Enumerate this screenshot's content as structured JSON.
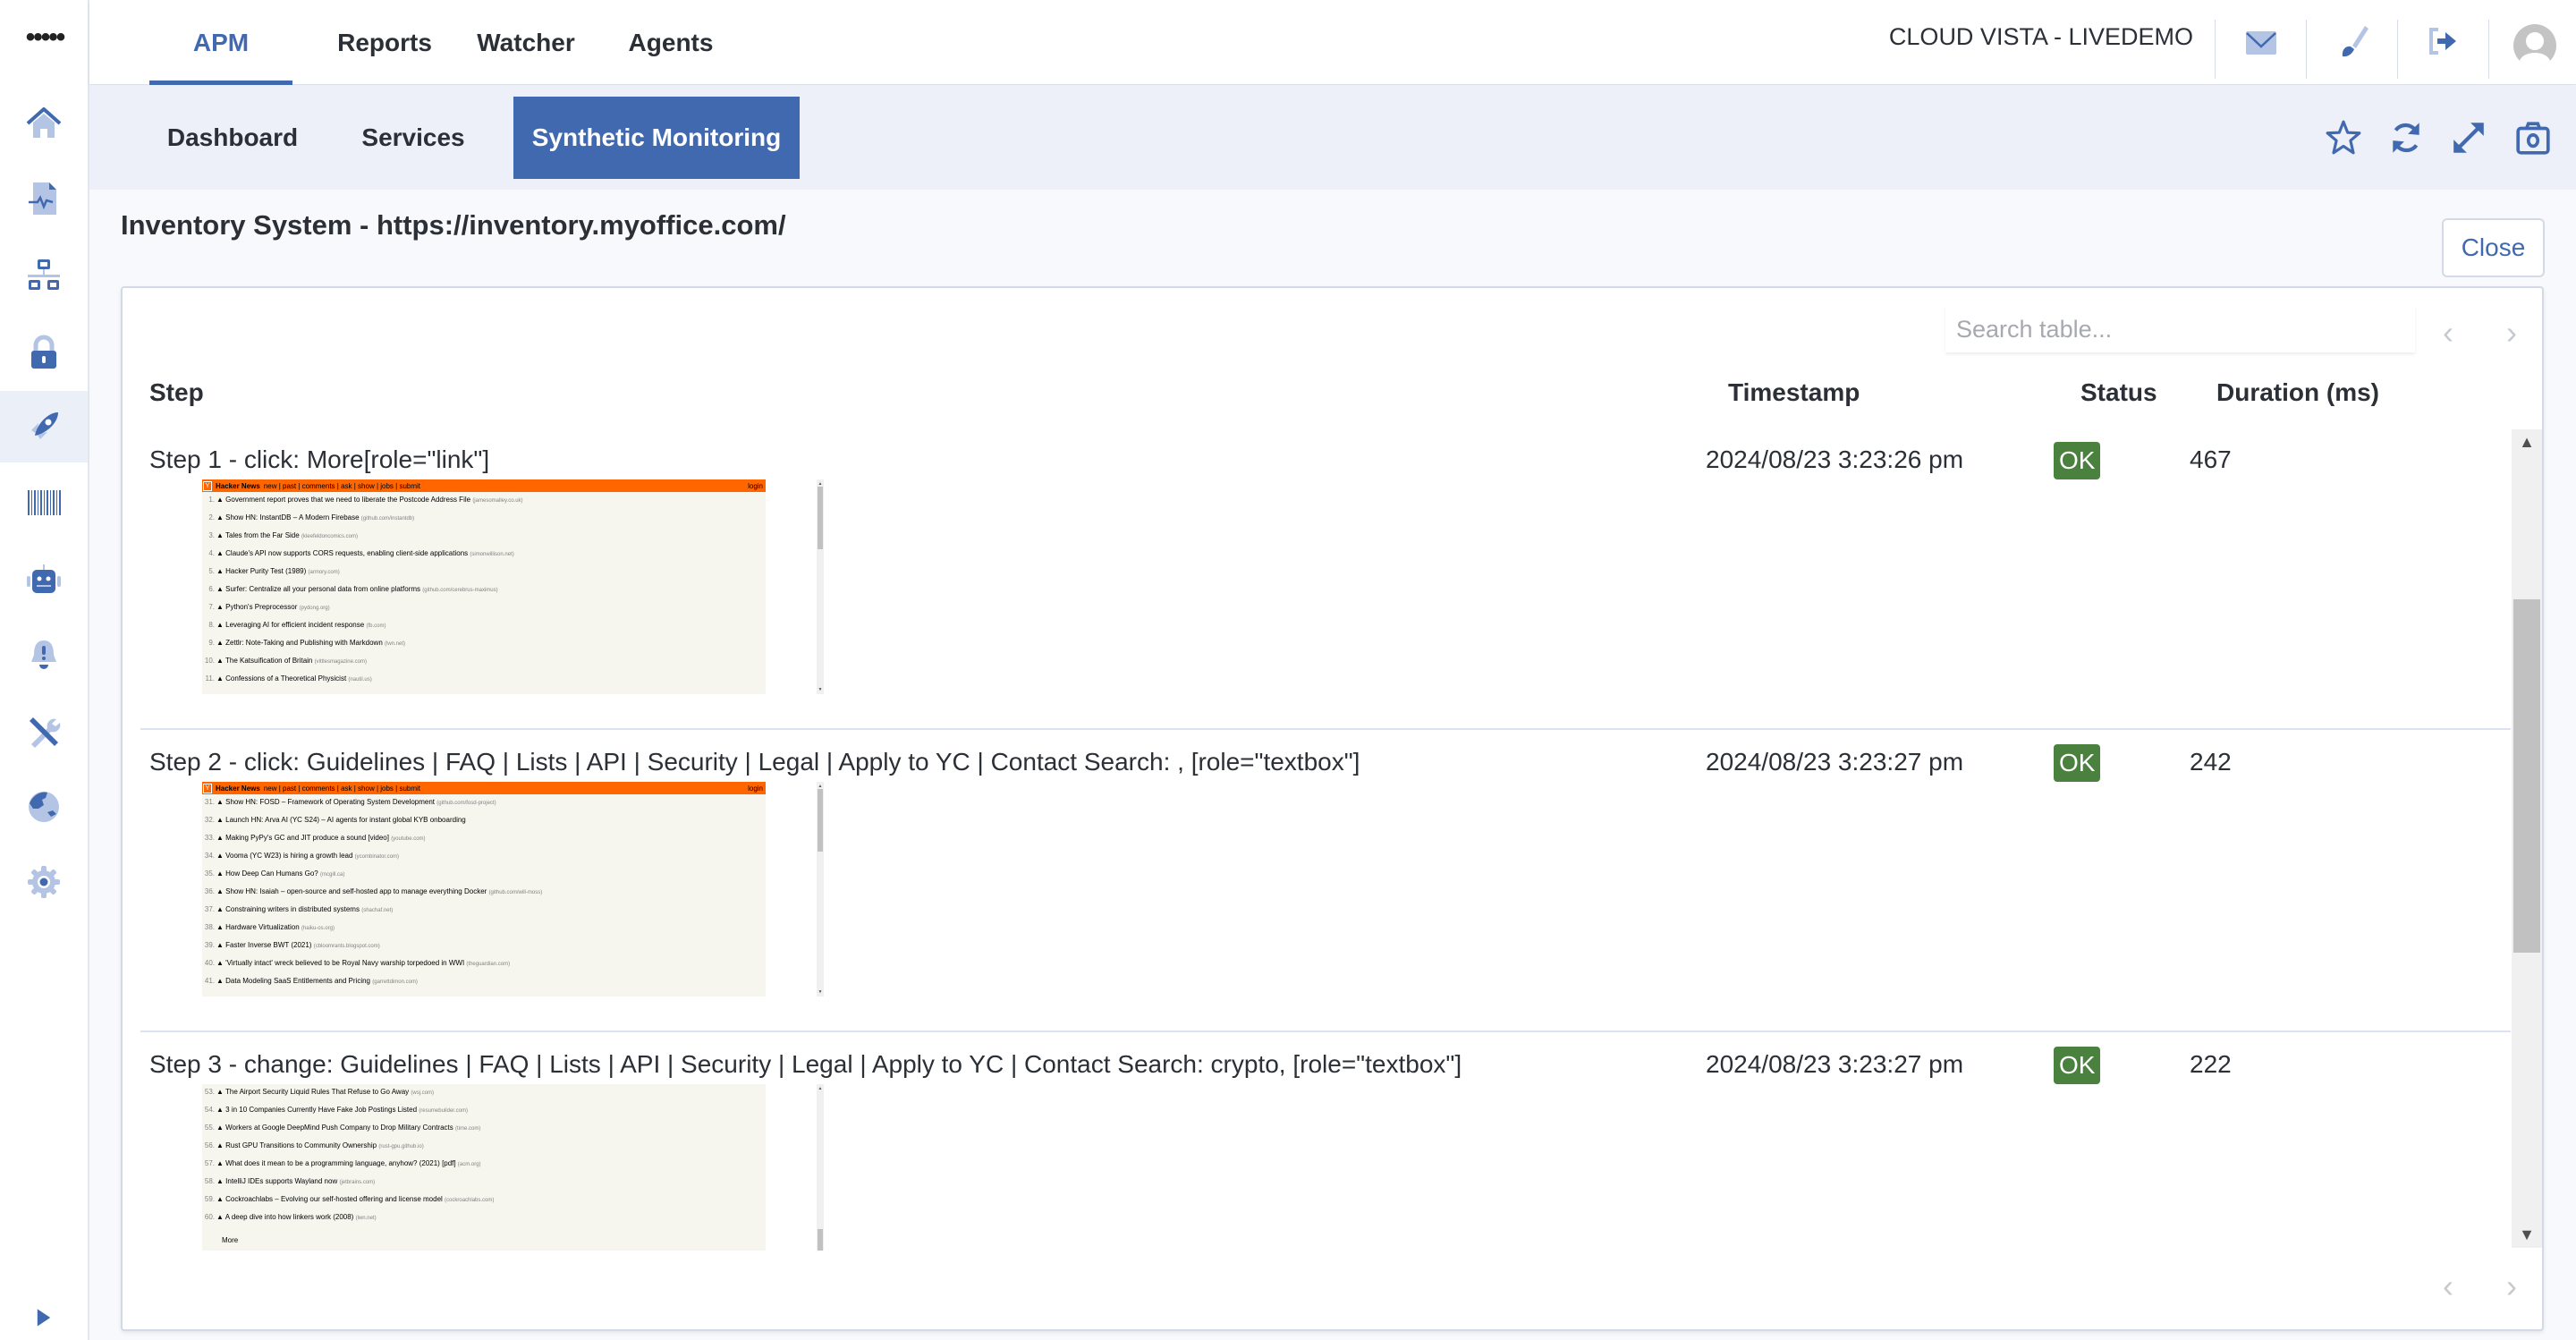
{
  "sidebar": {
    "menu_icon": "more-dots-icon",
    "items": [
      {
        "name": "home",
        "icon": "home-icon",
        "active": false
      },
      {
        "name": "reports",
        "icon": "file-pulse-icon",
        "active": false
      },
      {
        "name": "topology",
        "icon": "network-icon",
        "active": false
      },
      {
        "name": "security",
        "icon": "lock-icon",
        "active": false
      },
      {
        "name": "apm",
        "icon": "rocket-icon",
        "active": true
      },
      {
        "name": "inventory",
        "icon": "barcode-icon",
        "active": false
      },
      {
        "name": "agents",
        "icon": "robot-icon",
        "active": false
      },
      {
        "name": "alerts",
        "icon": "bell-alert-icon",
        "active": false
      },
      {
        "name": "tools",
        "icon": "tools-icon",
        "active": false
      },
      {
        "name": "map",
        "icon": "globe-icon",
        "active": false
      },
      {
        "name": "settings",
        "icon": "gear-icon",
        "active": false
      }
    ],
    "expand_icon": "expand-right-icon"
  },
  "topnav": {
    "tabs": [
      {
        "label": "APM",
        "active": true
      },
      {
        "label": "Reports",
        "active": false
      },
      {
        "label": "Watcher",
        "active": false
      },
      {
        "label": "Agents",
        "active": false
      }
    ],
    "tenant": "CLOUD VISTA - LIVEDEMO",
    "icons": [
      "mail-icon",
      "brush-icon",
      "logout-icon",
      "user-avatar-icon"
    ]
  },
  "subnav": {
    "tabs": [
      {
        "label": "Dashboard",
        "active": false
      },
      {
        "label": "Services",
        "active": false
      },
      {
        "label": "Synthetic Monitoring",
        "active": true
      }
    ],
    "icons": [
      "star-icon",
      "refresh-icon",
      "expand-icon",
      "camera-icon"
    ]
  },
  "page": {
    "title": "Inventory System - https://inventory.myoffice.com/",
    "close_label": "Close"
  },
  "table": {
    "search_placeholder": "Search table...",
    "pager_prev": "‹",
    "pager_next": "›",
    "columns": {
      "step": "Step",
      "timestamp": "Timestamp",
      "status": "Status",
      "duration": "Duration (ms)"
    },
    "rows": [
      {
        "step": "Step 1 - click: More[role=\"link\"]",
        "timestamp": "2024/08/23 3:23:26 pm",
        "status": "OK",
        "duration": "467",
        "screenshot": {
          "header": {
            "brand": "Hacker News",
            "links": "new | past | comments | ask | show | jobs | submit",
            "login": "login"
          },
          "items": [
            {
              "n": "1.",
              "title": "Government report proves that we need to liberate the Postcode Address File",
              "site": "(jamesomalley.co.uk)"
            },
            {
              "n": "2.",
              "title": "Show HN: InstantDB – A Modern Firebase",
              "site": "(github.com/instantdb)"
            },
            {
              "n": "3.",
              "title": "Tales from the Far Side",
              "site": "(kleefeldoncomics.com)"
            },
            {
              "n": "4.",
              "title": "Claude's API now supports CORS requests, enabling client-side applications",
              "site": "(simonwillison.net)"
            },
            {
              "n": "5.",
              "title": "Hacker Purity Test (1989)",
              "site": "(armory.com)"
            },
            {
              "n": "6.",
              "title": "Surfer: Centralize all your personal data from online platforms",
              "site": "(github.com/cerebrus-maximus)"
            },
            {
              "n": "7.",
              "title": "Python's Preprocessor",
              "site": "(pydong.org)"
            },
            {
              "n": "8.",
              "title": "Leveraging AI for efficient incident response",
              "site": "(fb.com)"
            },
            {
              "n": "9.",
              "title": "Zettlr: Note-Taking and Publishing with Markdown",
              "site": "(lwn.net)"
            },
            {
              "n": "10.",
              "title": "The Katsuification of Britain",
              "site": "(vittlesmagazine.com)"
            },
            {
              "n": "11.",
              "title": "Confessions of a Theoretical Physicist",
              "site": "(nautil.us)"
            }
          ],
          "scroll_position": 0.0
        }
      },
      {
        "step": "Step 2 - click: Guidelines | FAQ | Lists | API | Security | Legal | Apply to YC | Contact Search: , [role=\"textbox\"]",
        "timestamp": "2024/08/23 3:23:27 pm",
        "status": "OK",
        "duration": "242",
        "screenshot": {
          "header": {
            "brand": "Hacker News",
            "links": "new | past | comments | ask | show | jobs | submit",
            "login": "login"
          },
          "items": [
            {
              "n": "31.",
              "title": "Show HN: FOSD – Framework of Operating System Development",
              "site": "(github.com/fosd-project)"
            },
            {
              "n": "32.",
              "title": "Launch HN: Arva AI (YC S24) – AI agents for instant global KYB onboarding",
              "site": ""
            },
            {
              "n": "33.",
              "title": "Making PyPy's GC and JIT produce a sound [video]",
              "site": "(youtube.com)"
            },
            {
              "n": "34.",
              "title": "Vooma (YC W23) is hiring a growth lead",
              "site": "(ycombinator.com)"
            },
            {
              "n": "35.",
              "title": "How Deep Can Humans Go?",
              "site": "(mcgill.ca)"
            },
            {
              "n": "36.",
              "title": "Show HN: Isaiah – open-source and self-hosted app to manage everything Docker",
              "site": "(github.com/will-moss)"
            },
            {
              "n": "37.",
              "title": "Constraining writers in distributed systems",
              "site": "(shachaf.net)"
            },
            {
              "n": "38.",
              "title": "Hardware Virtualization",
              "site": "(haiku-os.org)"
            },
            {
              "n": "39.",
              "title": "Faster Inverse BWT (2021)",
              "site": "(cbloomrants.blogspot.com)"
            },
            {
              "n": "40.",
              "title": "'Virtually intact' wreck believed to be Royal Navy warship torpedoed in WWI",
              "site": "(theguardian.com)"
            },
            {
              "n": "41.",
              "title": "Data Modeling SaaS Entitlements and Pricing",
              "site": "(garrettdimon.com)"
            }
          ],
          "scroll_position": 0.0
        }
      },
      {
        "step": "Step 3 - change: Guidelines | FAQ | Lists | API | Security | Legal | Apply to YC | Contact Search: crypto, [role=\"textbox\"]",
        "timestamp": "2024/08/23 3:23:27 pm",
        "status": "OK",
        "duration": "222",
        "screenshot": {
          "header": null,
          "items": [
            {
              "n": "53.",
              "title": "The Airport Security Liquid Rules That Refuse to Go Away",
              "site": "(wsj.com)"
            },
            {
              "n": "54.",
              "title": "3 in 10 Companies Currently Have Fake Job Postings Listed",
              "site": "(resumebuilder.com)"
            },
            {
              "n": "55.",
              "title": "Workers at Google DeepMind Push Company to Drop Military Contracts",
              "site": "(time.com)"
            },
            {
              "n": "56.",
              "title": "Rust GPU Transitions to Community Ownership",
              "site": "(rust-gpu.github.io)"
            },
            {
              "n": "57.",
              "title": "What does it mean to be a programming language, anyhow? (2021) [pdf]",
              "site": "(acm.org)"
            },
            {
              "n": "58.",
              "title": "IntelliJ IDEs supports Wayland now",
              "site": "(jetbrains.com)"
            },
            {
              "n": "59.",
              "title": "Cockroachlabs – Evolving our self-hosted offering and license model",
              "site": "(cockroachlabs.com)"
            },
            {
              "n": "60.",
              "title": "A deep dive into how linkers work (2008)",
              "site": "(lwn.net)"
            }
          ],
          "more": "More",
          "scroll_position": 1.0
        }
      }
    ],
    "scroll_position": 0.35
  },
  "colors": {
    "accent": "#4169b0",
    "ok": "#4a813e",
    "hn_orange": "#ff6600"
  }
}
